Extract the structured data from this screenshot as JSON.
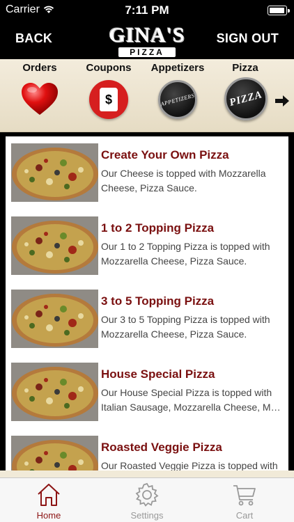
{
  "status_bar": {
    "carrier": "Carrier",
    "time": "7:11 PM"
  },
  "nav": {
    "back_label": "BACK",
    "signout_label": "SIGN OUT",
    "logo_line1": "GINA'S",
    "logo_line2": "PIZZA"
  },
  "categories": [
    {
      "label": "Orders",
      "icon": "heart-icon"
    },
    {
      "label": "Coupons",
      "icon": "price-tag-icon",
      "glyph": "$"
    },
    {
      "label": "Appetizers",
      "icon": "appetizers-badge-icon",
      "badge_text": "APPETIZERS"
    },
    {
      "label": "Pizza",
      "icon": "pizza-badge-icon",
      "badge_text": "PIZZA"
    }
  ],
  "menu_items": [
    {
      "title": "Create Your Own Pizza",
      "desc_line1": "Our Cheese is topped with Mozzarella",
      "desc_line2": "Cheese, Pizza Sauce."
    },
    {
      "title": "1 to 2 Topping Pizza",
      "desc_line1": "Our 1 to 2 Topping Pizza is topped with",
      "desc_line2": "Mozzarella Cheese, Pizza Sauce."
    },
    {
      "title": "3 to 5 Topping Pizza",
      "desc_line1": "Our 3 to 5 Topping Pizza is topped with",
      "desc_line2": "Mozzarella Cheese, Pizza Sauce."
    },
    {
      "title": "House Special Pizza",
      "desc_line1": "Our House Special Pizza is topped with",
      "desc_line2": "Italian Sausage, Mozzarella Cheese, Mu..."
    },
    {
      "title": "Roasted Veggie Pizza",
      "desc_line1": "Our Roasted Veggie Pizza is topped with",
      "desc_line2": ""
    }
  ],
  "tabs": [
    {
      "label": "Home",
      "icon": "home-icon",
      "active": true
    },
    {
      "label": "Settings",
      "icon": "gear-icon",
      "active": false
    },
    {
      "label": "Cart",
      "icon": "cart-icon",
      "active": false
    }
  ],
  "colors": {
    "accent": "#7a1010",
    "tab_active": "#8c1414",
    "tab_inactive": "#999999",
    "strip_bg": "#f3ecdc"
  }
}
